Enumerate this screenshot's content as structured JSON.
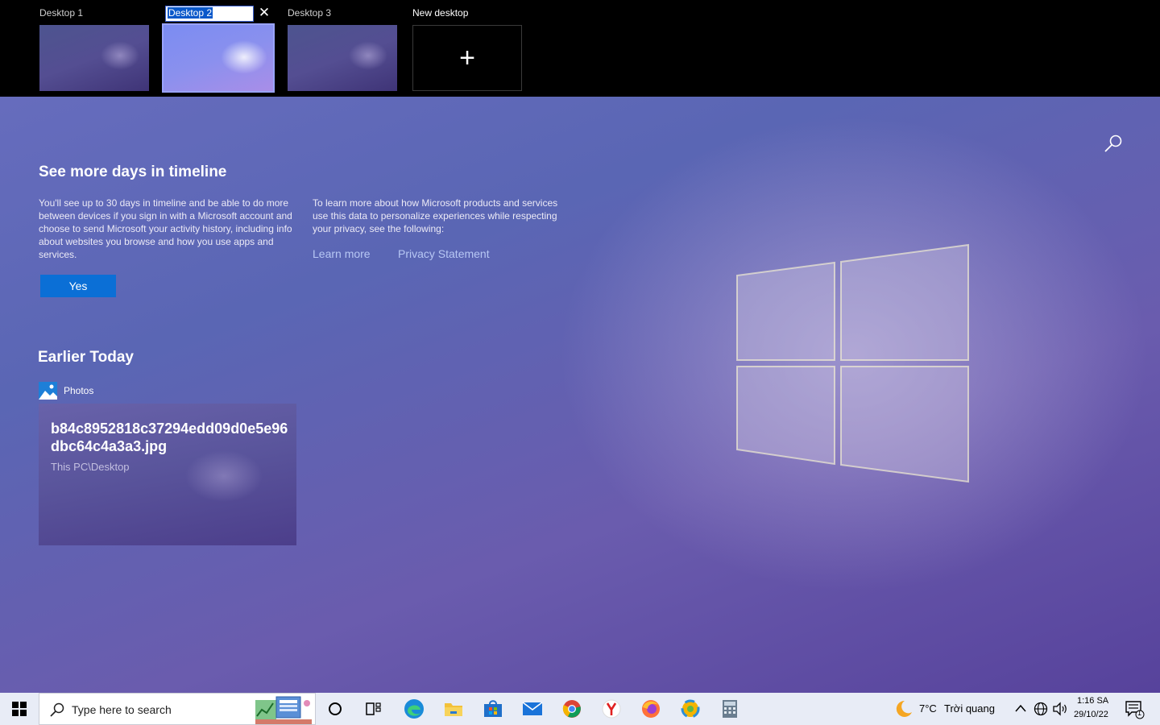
{
  "desktops": {
    "items": [
      {
        "label": "Desktop 1"
      },
      {
        "label": "Desktop 2"
      },
      {
        "label": "Desktop 3"
      }
    ],
    "new_desktop_label": "New desktop",
    "rename_value": "Desktop 2",
    "close_glyph": "✕",
    "plus_glyph": "+"
  },
  "timeline": {
    "title": "See more days in timeline",
    "left_text": "You'll see up to 30 days in timeline and be able to do more between devices if you sign in with a Microsoft account and choose to send Microsoft your activity history, including info about websites you browse and how you use apps and services.",
    "right_text": "To learn more about how Microsoft products and services use this data to personalize experiences while respecting your privacy, see the following:",
    "learn_more": "Learn more",
    "privacy": "Privacy Statement",
    "yes_label": "Yes"
  },
  "earlier": {
    "title": "Earlier Today",
    "app_name": "Photos",
    "file_name": "b84c8952818c37294edd09d0e5e96dbc64c4a3a3.jpg",
    "file_path": "This PC\\Desktop"
  },
  "taskbar": {
    "search_placeholder": "Type here to search",
    "icons": [
      "windows-start-icon",
      "cortana-icon",
      "task-view-icon",
      "edge-icon",
      "file-explorer-icon",
      "store-icon",
      "mail-icon",
      "chrome-icon",
      "yandex-icon",
      "firefox-icon",
      "photos-taskbar-icon",
      "calculator-icon"
    ],
    "weather_temp": "7°C",
    "weather_desc": "Trời quang",
    "time": "1:16 SA",
    "date": "29/10/22",
    "notification_count": "1"
  },
  "colors": {
    "accent": "#0b6fd6",
    "link": "#b7c7f4",
    "taskbar_bg": "#e8ecf6"
  }
}
